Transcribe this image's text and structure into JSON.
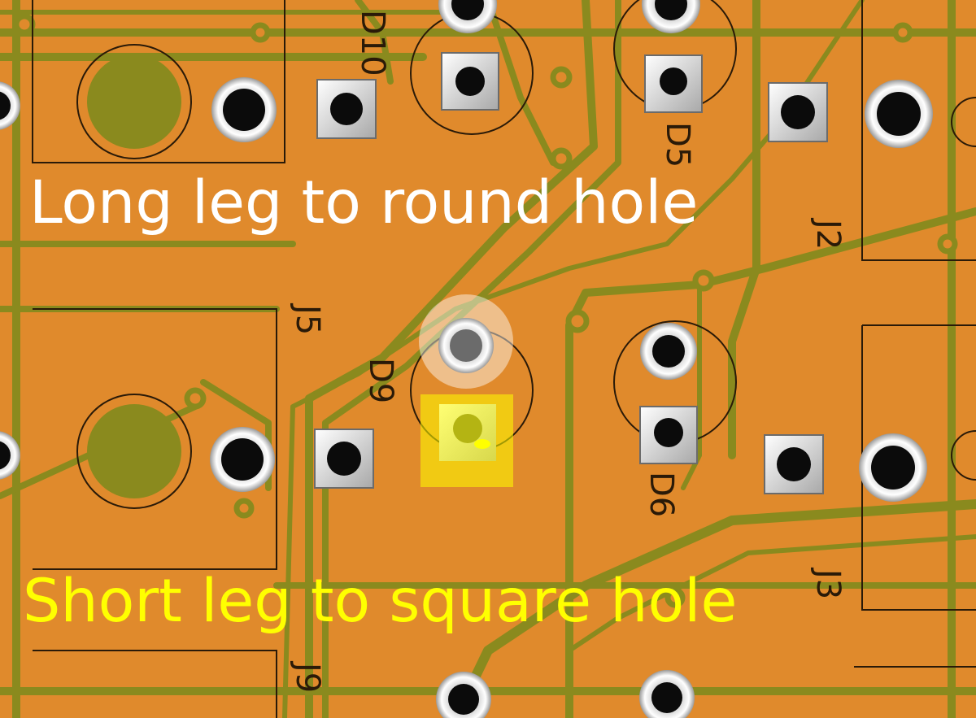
{
  "captions": {
    "top": "Long leg to round hole",
    "bottom": "Short leg to square hole"
  },
  "silkscreen": {
    "d10": "D10",
    "d5": "D5",
    "d9": "D9",
    "d6": "D6",
    "j2": "J2",
    "j3": "J3",
    "j5": "J5",
    "j9": "J9"
  },
  "colors": {
    "board_orange": "#e08a2c",
    "trace_olive": "#8a8a1e",
    "highlight_yellow": "#ffff00",
    "caption_white": "#ffffff"
  }
}
